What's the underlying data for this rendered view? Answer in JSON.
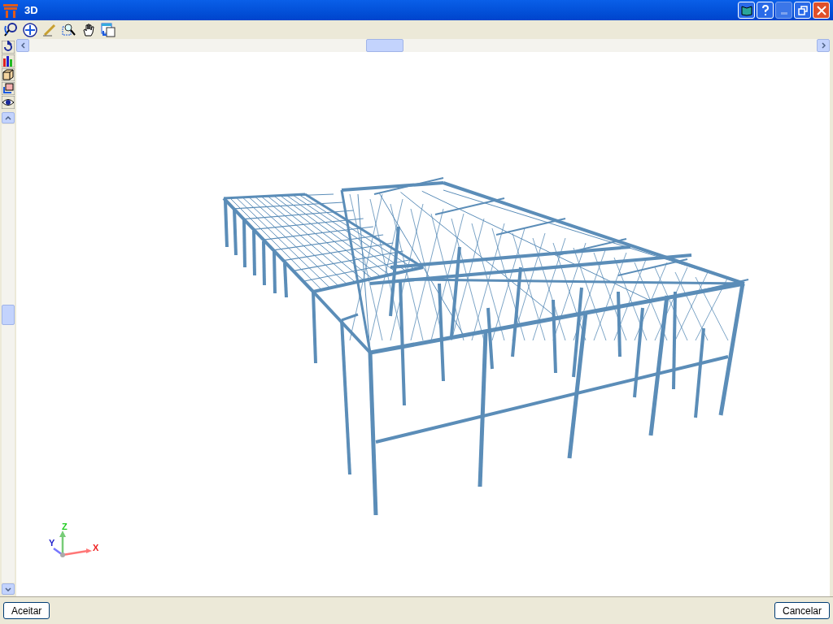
{
  "window": {
    "title": "3D"
  },
  "axes": {
    "x": "X",
    "y": "Y",
    "z": "Z"
  },
  "buttons": [
    {
      "label": "Aceitar"
    },
    {
      "label": "Cancelar"
    }
  ]
}
